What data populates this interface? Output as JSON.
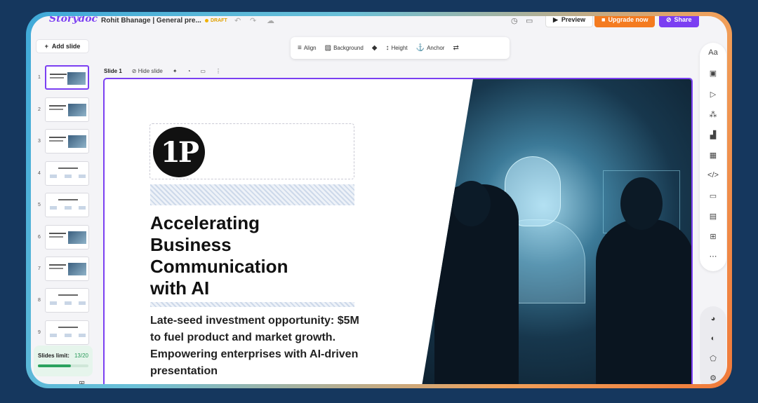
{
  "app": {
    "logo": "Storydoc",
    "doc_name": "Rohit Bhanage | General pre...",
    "status": "DRAFT"
  },
  "header": {
    "preview_label": "Preview",
    "upgrade_label": "Upgrade now",
    "share_label": "Share"
  },
  "sidebar": {
    "add_slide_label": "Add slide",
    "slides": [
      "1",
      "2",
      "3",
      "4",
      "5",
      "6",
      "7",
      "8",
      "9"
    ],
    "limit_label": "Slides limit:",
    "limit_count": "13/20",
    "limit_fraction": 0.65
  },
  "toolbar": {
    "align": "Align",
    "background": "Background",
    "height": "Height",
    "anchor": "Anchor"
  },
  "slidebar": {
    "name": "Slide 1",
    "hide": "Hide slide"
  },
  "slide": {
    "title": "Accelerating\nBusiness\nCommunication\nwith AI",
    "subtitle": "Late-seed investment opportunity: $5M to fuel product and market growth. Empowering enterprises with AI-driven presentation",
    "logo_text": "1P"
  },
  "colors": {
    "accent": "#7b3ff2",
    "upgrade": "#f47b20",
    "frame_bg": "#15375e"
  },
  "rail_icons": [
    "text-icon",
    "image-icon",
    "video-icon",
    "widgets-icon",
    "chart-icon",
    "table-icon",
    "code-icon",
    "button-icon",
    "calendar-icon",
    "grid-icon",
    "more-icon"
  ],
  "rail2_icons": [
    "palette-icon",
    "brain-icon",
    "plugin-icon",
    "settings-icon"
  ]
}
